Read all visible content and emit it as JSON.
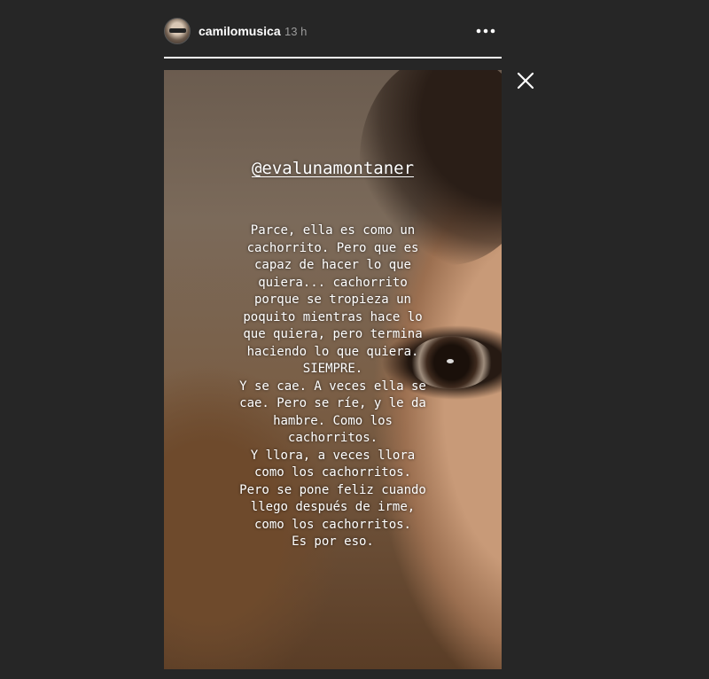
{
  "header": {
    "username": "camilomusica",
    "time": "13 h",
    "more_icon": "more-horizontal-icon",
    "progress": 1.0
  },
  "close_icon": "close-icon",
  "story": {
    "mention": "@evalunamontaner",
    "lines": [
      "Parce, ella es como un",
      "cachorrito. Pero que es",
      "capaz de hacer lo que",
      "quiera... cachorrito",
      "porque se tropieza un",
      "poquito mientras hace lo",
      "que quiera, pero termina",
      "haciendo lo que quiera.",
      "SIEMPRE.",
      "Y se cae. A veces ella se",
      "cae. Pero se ríe, y le da",
      "hambre. Como los",
      "cachorritos.",
      "Y llora, a veces llora",
      "como los cachorritos.",
      "Pero se pone feliz cuando",
      "llego después de irme,",
      "como los cachorritos.",
      "Es por eso."
    ]
  },
  "colors": {
    "background": "#262626",
    "text": "#ffffff",
    "muted": "#9a9a9a"
  }
}
